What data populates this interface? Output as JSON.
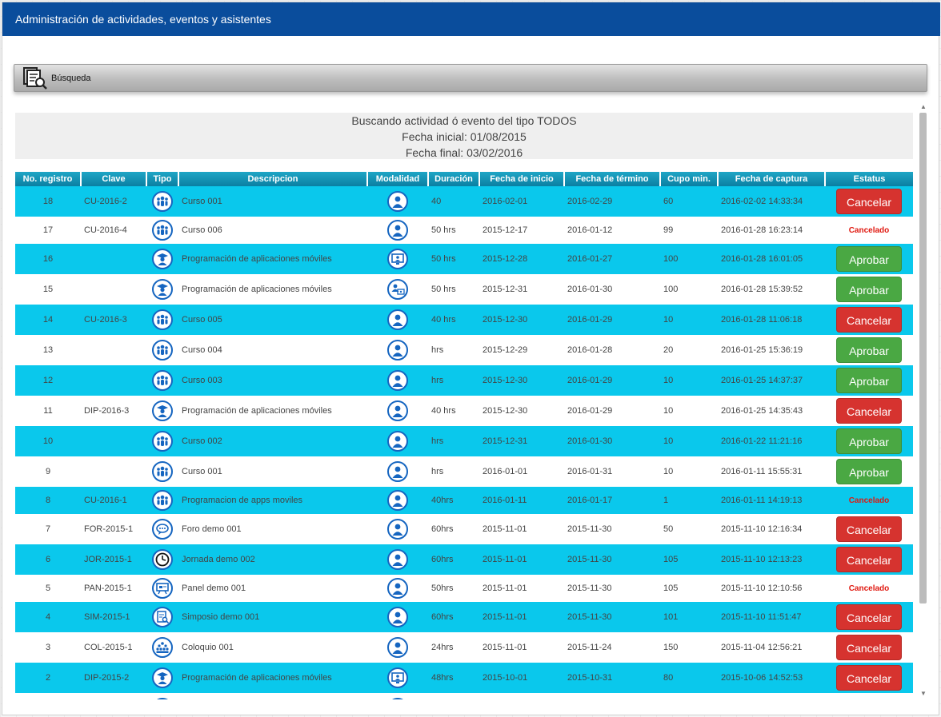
{
  "header": {
    "title": "Administración de actividades, eventos y asistentes"
  },
  "search_bar": {
    "label": "Búsqueda",
    "icon": "search-document-icon"
  },
  "criteria": {
    "line1": "Buscando actividad ó evento del tipo TODOS",
    "line2": "Fecha inicial: 01/08/2015",
    "line3": "Fecha final: 03/02/2016"
  },
  "table": {
    "columns": [
      "No. registro",
      "Clave",
      "Tipo",
      "Descripcion",
      "Modalidad",
      "Duración",
      "Fecha de inicio",
      "Fecha de término",
      "Cupo min.",
      "Fecha de captura",
      "Estatus"
    ],
    "rows": [
      {
        "no": "18",
        "clave": "CU-2016-2",
        "tipo": "people-group-icon",
        "descripcion": "Curso 001",
        "modalidad": "person-icon",
        "duracion": "40",
        "inicio": "2016-02-01",
        "termino": "2016-02-29",
        "cupo": "60",
        "captura": "2016-02-02 14:33:34",
        "estatus": "Cancelar",
        "estatus_kind": "button-red"
      },
      {
        "no": "17",
        "clave": "CU-2016-4",
        "tipo": "people-group-icon",
        "descripcion": "Curso 006",
        "modalidad": "person-icon",
        "duracion": "50 hrs",
        "inicio": "2015-12-17",
        "termino": "2016-01-12",
        "cupo": "99",
        "captura": "2016-01-28 16:23:14",
        "estatus": "Cancelado",
        "estatus_kind": "text"
      },
      {
        "no": "16",
        "clave": "",
        "tipo": "graduate-icon",
        "descripcion": "Programación de aplicaciones móviles",
        "modalidad": "monitor-icon",
        "duracion": "50 hrs",
        "inicio": "2015-12-28",
        "termino": "2016-01-27",
        "cupo": "100",
        "captura": "2016-01-28 16:01:05",
        "estatus": "Aprobar",
        "estatus_kind": "button-green"
      },
      {
        "no": "15",
        "clave": "",
        "tipo": "graduate-icon",
        "descripcion": "Programación de aplicaciones móviles",
        "modalidad": "blended-icon",
        "duracion": "50 hrs",
        "inicio": "2015-12-31",
        "termino": "2016-01-30",
        "cupo": "100",
        "captura": "2016-01-28 15:39:52",
        "estatus": "Aprobar",
        "estatus_kind": "button-green"
      },
      {
        "no": "14",
        "clave": "CU-2016-3",
        "tipo": "people-group-icon",
        "descripcion": "Curso 005",
        "modalidad": "person-icon",
        "duracion": "40 hrs",
        "inicio": "2015-12-30",
        "termino": "2016-01-29",
        "cupo": "10",
        "captura": "2016-01-28 11:06:18",
        "estatus": "Cancelar",
        "estatus_kind": "button-red"
      },
      {
        "no": "13",
        "clave": "",
        "tipo": "people-group-icon",
        "descripcion": "Curso 004",
        "modalidad": "person-icon",
        "duracion": "hrs",
        "inicio": "2015-12-29",
        "termino": "2016-01-28",
        "cupo": "20",
        "captura": "2016-01-25 15:36:19",
        "estatus": "Aprobar",
        "estatus_kind": "button-green"
      },
      {
        "no": "12",
        "clave": "",
        "tipo": "people-group-icon",
        "descripcion": "Curso 003",
        "modalidad": "person-icon",
        "duracion": "hrs",
        "inicio": "2015-12-30",
        "termino": "2016-01-29",
        "cupo": "10",
        "captura": "2016-01-25 14:37:37",
        "estatus": "Aprobar",
        "estatus_kind": "button-green"
      },
      {
        "no": "11",
        "clave": "DIP-2016-3",
        "tipo": "graduate-icon",
        "descripcion": "Programación de aplicaciones móviles",
        "modalidad": "person-icon",
        "duracion": "40 hrs",
        "inicio": "2015-12-30",
        "termino": "2016-01-29",
        "cupo": "10",
        "captura": "2016-01-25 14:35:43",
        "estatus": "Cancelar",
        "estatus_kind": "button-red"
      },
      {
        "no": "10",
        "clave": "",
        "tipo": "people-group-icon",
        "descripcion": "Curso 002",
        "modalidad": "person-icon",
        "duracion": "hrs",
        "inicio": "2015-12-31",
        "termino": "2016-01-30",
        "cupo": "10",
        "captura": "2016-01-22 11:21:16",
        "estatus": "Aprobar",
        "estatus_kind": "button-green"
      },
      {
        "no": "9",
        "clave": "",
        "tipo": "people-group-icon",
        "descripcion": "Curso 001",
        "modalidad": "person-icon",
        "duracion": "hrs",
        "inicio": "2016-01-01",
        "termino": "2016-01-31",
        "cupo": "10",
        "captura": "2016-01-11 15:55:31",
        "estatus": "Aprobar",
        "estatus_kind": "button-green"
      },
      {
        "no": "8",
        "clave": "CU-2016-1",
        "tipo": "people-group-icon",
        "descripcion": "Programacion de apps moviles",
        "modalidad": "person-icon",
        "duracion": "40hrs",
        "inicio": "2016-01-11",
        "termino": "2016-01-17",
        "cupo": "1",
        "captura": "2016-01-11 14:19:13",
        "estatus": "Cancelado",
        "estatus_kind": "text"
      },
      {
        "no": "7",
        "clave": "FOR-2015-1",
        "tipo": "chat-icon",
        "descripcion": "Foro demo 001",
        "modalidad": "person-icon",
        "duracion": "60hrs",
        "inicio": "2015-11-01",
        "termino": "2015-11-30",
        "cupo": "50",
        "captura": "2015-11-10 12:16:34",
        "estatus": "Cancelar",
        "estatus_kind": "button-red"
      },
      {
        "no": "6",
        "clave": "JOR-2015-1",
        "tipo": "clock-icon",
        "descripcion": "Jornada demo 002",
        "modalidad": "person-icon",
        "duracion": "60hrs",
        "inicio": "2015-11-01",
        "termino": "2015-11-30",
        "cupo": "105",
        "captura": "2015-11-10 12:13:23",
        "estatus": "Cancelar",
        "estatus_kind": "button-red"
      },
      {
        "no": "5",
        "clave": "PAN-2015-1",
        "tipo": "presentation-board-icon",
        "descripcion": "Panel demo 001",
        "modalidad": "person-icon",
        "duracion": "50hrs",
        "inicio": "2015-11-01",
        "termino": "2015-11-30",
        "cupo": "105",
        "captura": "2015-11-10 12:10:56",
        "estatus": "Cancelado",
        "estatus_kind": "text"
      },
      {
        "no": "4",
        "clave": "SIM-2015-1",
        "tipo": "document-search-icon",
        "descripcion": "Simposio demo 001",
        "modalidad": "person-icon",
        "duracion": "60hrs",
        "inicio": "2015-11-01",
        "termino": "2015-11-30",
        "cupo": "101",
        "captura": "2015-11-10 11:51:47",
        "estatus": "Cancelar",
        "estatus_kind": "button-red"
      },
      {
        "no": "3",
        "clave": "COL-2015-1",
        "tipo": "audience-icon",
        "descripcion": "Coloquio 001",
        "modalidad": "person-icon",
        "duracion": "24hrs",
        "inicio": "2015-11-01",
        "termino": "2015-11-24",
        "cupo": "150",
        "captura": "2015-11-04 12:56:21",
        "estatus": "Cancelar",
        "estatus_kind": "button-red"
      },
      {
        "no": "2",
        "clave": "DIP-2015-2",
        "tipo": "graduate-icon",
        "descripcion": "Programación de aplicaciones móviles",
        "modalidad": "monitor-icon",
        "duracion": "48hrs",
        "inicio": "2015-10-01",
        "termino": "2015-10-31",
        "cupo": "80",
        "captura": "2015-10-06 14:52:53",
        "estatus": "Cancelar",
        "estatus_kind": "button-red"
      },
      {
        "no": "",
        "clave": "",
        "tipo": "people-group-icon",
        "descripcion": "",
        "modalidad": "person-icon",
        "duracion": "",
        "inicio": "",
        "termino": "",
        "cupo": "",
        "captura": "",
        "estatus": "",
        "estatus_kind": "none"
      }
    ]
  },
  "colors": {
    "header_bg": "#0a4d9c",
    "row_alt": "#0ac8ec",
    "cancel_red": "#d6332f",
    "approve_green": "#4aa843",
    "cancelled_text": "#e0180f"
  }
}
